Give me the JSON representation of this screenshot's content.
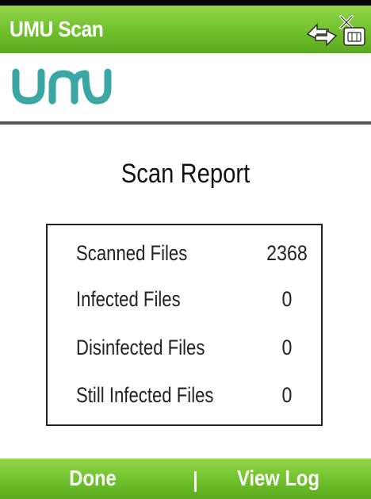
{
  "app": {
    "title": "UMU Scan",
    "brand_color": "#6fc02b",
    "logo_color": "#3aa7a5",
    "logo_text": "umu"
  },
  "status_icons": [
    {
      "name": "sync-connection-icon"
    },
    {
      "name": "no-sim-icon"
    }
  ],
  "report": {
    "title": "Scan Report",
    "rows": [
      {
        "label": "Scanned Files",
        "value": "2368"
      },
      {
        "label": "Infected Files",
        "value": "0"
      },
      {
        "label": "Disinfected Files",
        "value": "0"
      },
      {
        "label": "Still Infected Files",
        "value": "0"
      }
    ]
  },
  "softkeys": {
    "left_label": "Done",
    "right_label": "View Log"
  }
}
